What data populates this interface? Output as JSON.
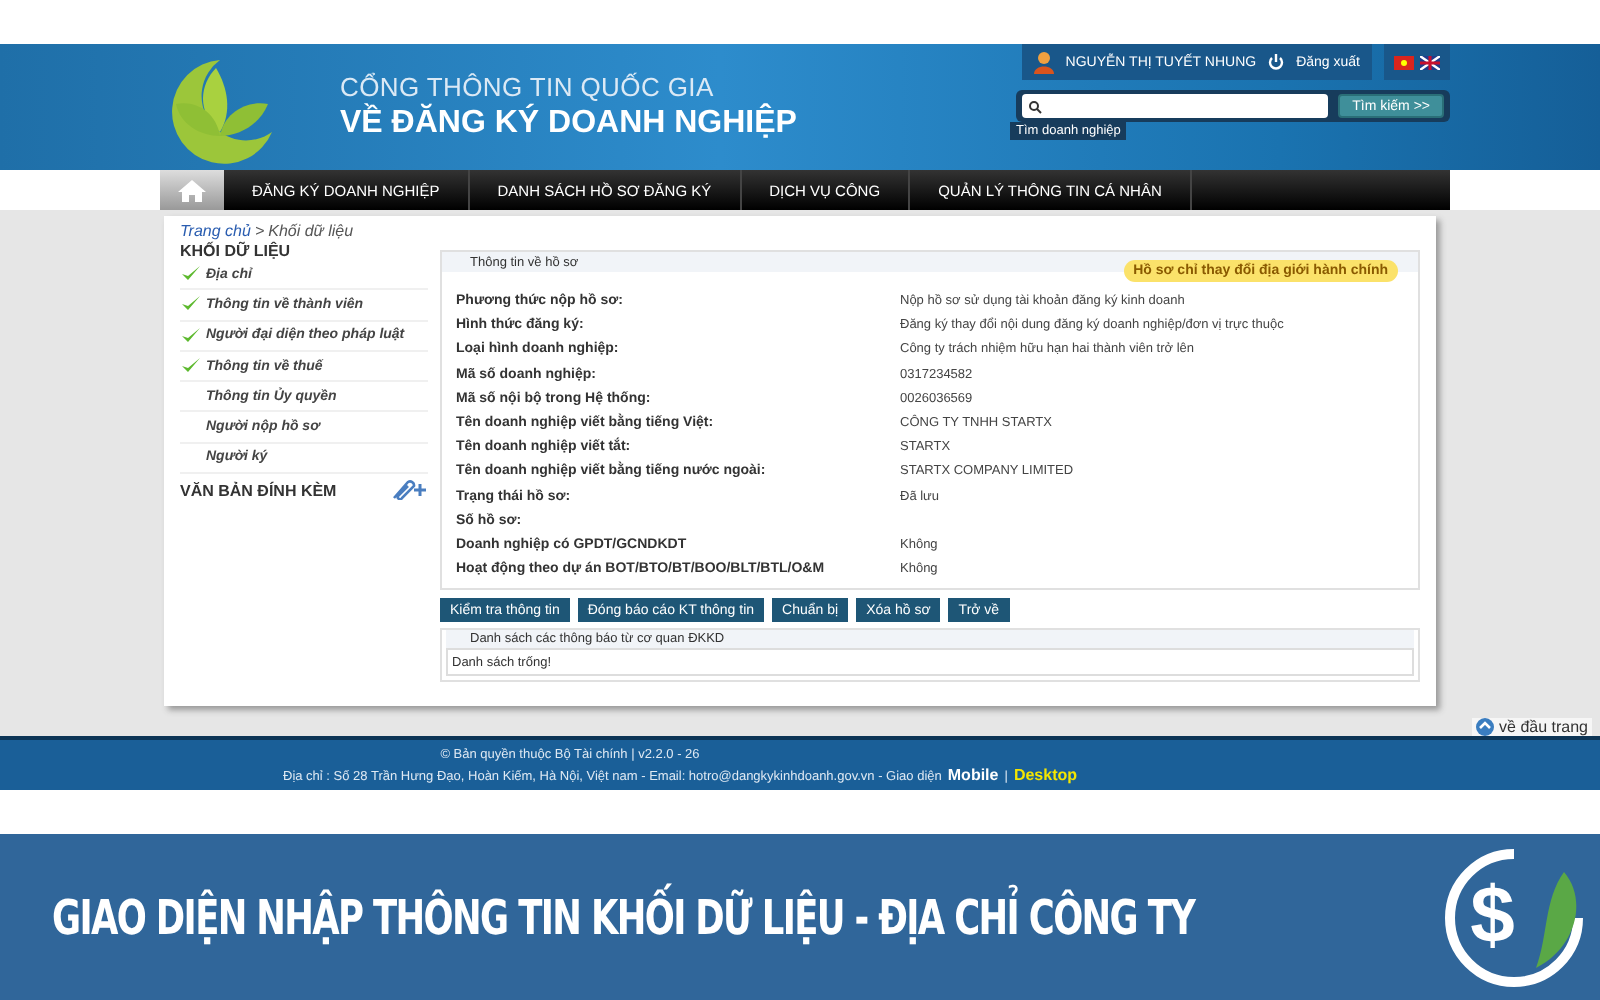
{
  "header": {
    "title_top": "CỔNG THÔNG TIN QUỐC GIA",
    "title_main": "VỀ ĐĂNG KÝ DOANH NGHIỆP",
    "user_name": "NGUYỄN THỊ TUYẾT NHUNG",
    "logout": "Đăng xuất",
    "search_button": "Tìm kiếm >>",
    "search_hint": "Tìm doanh nghiệp"
  },
  "nav": [
    {
      "label": "ĐĂNG KÝ DOANH NGHIỆP",
      "selected": false
    },
    {
      "label": "DANH SÁCH HỒ SƠ ĐĂNG KÝ",
      "selected": false
    },
    {
      "label": "DỊCH VỤ CÔNG",
      "selected": false
    },
    {
      "label": "QUẢN LÝ THÔNG TIN CÁ NHÂN",
      "selected": false
    }
  ],
  "breadcrumb": {
    "link": "Trang chủ",
    "separator": ">",
    "current": "Khối dữ liệu"
  },
  "sidebar": {
    "title": "KHỐI DỮ LIỆU",
    "items": [
      {
        "label": "Địa chỉ",
        "checked": true
      },
      {
        "label": "Thông tin về thành viên",
        "checked": true
      },
      {
        "label": "Người đại diện theo pháp luật",
        "checked": true
      },
      {
        "label": "Thông tin về thuế",
        "checked": true
      },
      {
        "label": "Thông tin Ủy quyền",
        "checked": false
      },
      {
        "label": "Người nộp hồ sơ",
        "checked": false
      },
      {
        "label": "Người ký",
        "checked": false
      }
    ],
    "attachments": "VĂN BẢN ĐÍNH KÈM"
  },
  "panel": {
    "title": "Thông tin về hồ sơ",
    "badge": "Hồ sơ chỉ thay đổi địa giới hành chính",
    "rows": [
      {
        "label": "Phương thức nộp hồ sơ:",
        "value": "Nộp hồ sơ sử dụng tài khoản đăng ký kinh doanh"
      },
      {
        "label": "Hình thức đăng ký:",
        "value": "Đăng ký thay đổi nội dung đăng ký doanh nghiệp/đơn vị trực thuộc"
      },
      {
        "label": "Loại hình doanh nghiệp:",
        "value": "Công ty trách nhiệm hữu hạn hai thành viên trở lên"
      },
      {
        "label": "Mã số doanh nghiệp:",
        "value": "0317234582"
      },
      {
        "label": "Mã số nội bộ trong Hệ thống:",
        "value": "0026036569"
      },
      {
        "label": "Tên doanh nghiệp viết bằng tiếng Việt:",
        "value": "CÔNG TY TNHH STARTX"
      },
      {
        "label": "Tên doanh nghiệp viết tắt:",
        "value": "STARTX"
      },
      {
        "label": "Tên doanh nghiệp viết bằng tiếng nước ngoài:",
        "value": "STARTX COMPANY LIMITED"
      },
      {
        "label": "Trạng thái hồ sơ:",
        "value": "Đã lưu"
      },
      {
        "label": "Số hồ sơ:"
      },
      {
        "label": "Doanh nghiệp có GPDT/GCNDKDT",
        "value": "Không"
      },
      {
        "label": "Hoạt động theo dự án BOT/BTO/BT/BOO/BLT/BTL/O&M",
        "value": "Không"
      }
    ]
  },
  "buttons": [
    "Kiểm tra thông tin",
    "Đóng báo cáo KT thông tin",
    "Chuẩn bị",
    "Xóa hồ sơ",
    "Trở về"
  ],
  "notices": {
    "title": "Danh sách các thông báo từ cơ quan ĐKKD",
    "empty": "Danh sách trống!"
  },
  "back_to_top": "về đầu trang",
  "footer": {
    "copyright": "© Bản quyền thuộc Bộ Tài chính | v2.2.0 - 26",
    "address": "Địa chỉ : Số 28 Trần Hưng Đạo, Hoàn Kiếm, Hà Nội, Việt nam - Email: hotro@dangkykinhdoanh.gov.vn - Giao diện",
    "mobile": "Mobile",
    "separator": "|",
    "desktop": "Desktop"
  },
  "banner": {
    "caption": "GIAO DIỆN NHẬP THÔNG TIN KHỐI DỮ LIỆU - ĐỊA CHỈ CÔNG TY",
    "logo_symbol": "$"
  }
}
